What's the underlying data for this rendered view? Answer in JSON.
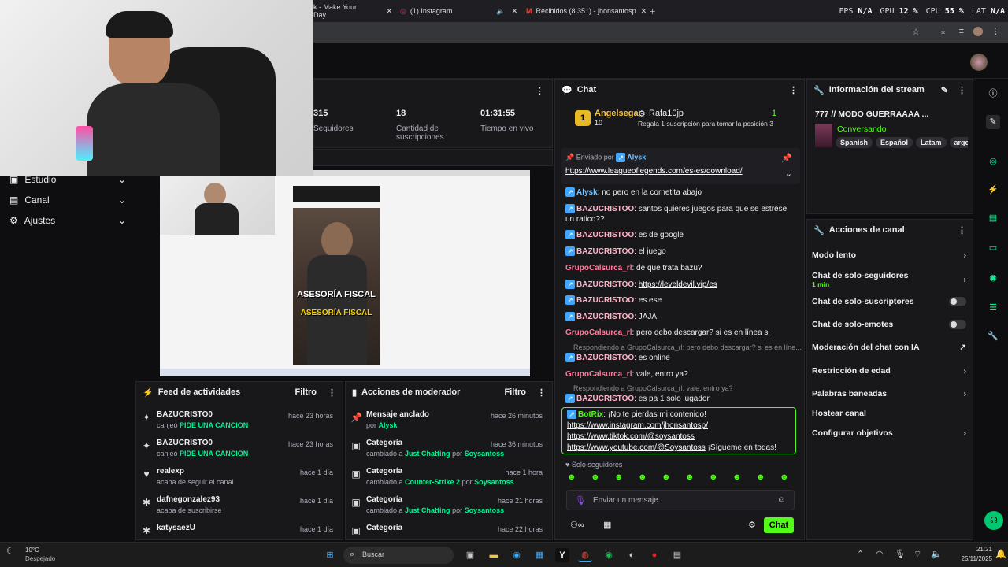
{
  "browser": {
    "tabs": [
      {
        "label": "k - Make Your Day"
      },
      {
        "label": "(1) Instagram"
      },
      {
        "label": "Recibidos (8,351) - jhonsantosp"
      }
    ],
    "hud": {
      "fps_label": "FPS",
      "fps": "N/A",
      "gpu_label": "GPU",
      "gpu": "12 %",
      "cpu_label": "CPU",
      "cpu": "55 %",
      "lat_label": "LAT",
      "lat": "N/A"
    }
  },
  "leftnav": {
    "items": [
      {
        "label": "Estudio"
      },
      {
        "label": "Canal"
      },
      {
        "label": "Ajustes"
      }
    ]
  },
  "stats": [
    {
      "value": "315",
      "label": "Seguidores"
    },
    {
      "value": "18",
      "label": "Cantidad de suscripciones"
    },
    {
      "value": "01:31:55",
      "label": "Tiempo en vivo"
    }
  ],
  "preview": {
    "overlay_line1": "ASESORÍA FISCAL",
    "overlay_line2": "ASESORÍA FISCAL"
  },
  "feed": {
    "title": "Feed de actividades",
    "filter": "Filtro",
    "items": [
      {
        "name": "BAZUCRISTO0",
        "action": "canjeó",
        "reward": "PIDE UNA CANCION",
        "time": "hace 23 horas",
        "icon": "points-icon"
      },
      {
        "name": "BAZUCRISTO0",
        "action": "canjeó",
        "reward": "PIDE UNA CANCION",
        "time": "hace 23 horas",
        "icon": "points-icon"
      },
      {
        "name": "realexp",
        "action": "acaba de seguir el canal",
        "reward": "",
        "time": "hace 1 día",
        "icon": "heart-icon"
      },
      {
        "name": "dafnegonzalez93",
        "action": "acaba de suscribirse",
        "reward": "",
        "time": "hace 1 día",
        "icon": "star-icon"
      },
      {
        "name": "katysaezU",
        "action": "",
        "reward": "",
        "time": "hace 1 día",
        "icon": "star-icon"
      }
    ]
  },
  "modactions": {
    "title": "Acciones de moderador",
    "filter": "Filtro",
    "items": [
      {
        "name": "Mensaje anclado",
        "line": "por",
        "a": "Alysk",
        "b": "",
        "by": "",
        "time": "hace 26 minutos",
        "icon": "pin-icon"
      },
      {
        "name": "Categoría",
        "line": "cambiado a",
        "a": "Just Chatting",
        "b": "por",
        "by": "Soysantoss",
        "time": "hace 36 minutos",
        "icon": "category-icon"
      },
      {
        "name": "Categoría",
        "line": "cambiado a",
        "a": "Counter-Strike 2",
        "b": "por",
        "by": "Soysantoss",
        "time": "hace 1 hora",
        "icon": "category-icon"
      },
      {
        "name": "Categoría",
        "line": "cambiado a",
        "a": "Just Chatting",
        "b": "por",
        "by": "Soysantoss",
        "time": "hace 21 horas",
        "icon": "category-icon"
      },
      {
        "name": "Categoría",
        "line": "",
        "a": "",
        "b": "",
        "by": "",
        "time": "hace 22 horas",
        "icon": "category-icon"
      }
    ]
  },
  "chat": {
    "title": "Chat",
    "leader": {
      "rank": "1",
      "name": "Angelsega",
      "count": "10",
      "other": "Rafa10jp",
      "other_count": "1",
      "promo": "Regala 1 suscripción para tomar la posición 3"
    },
    "pinned": {
      "by_label": "Enviado por",
      "by": "Alysk",
      "link": "https://www.leagueoflegends.com/es-es/download/"
    },
    "messages": [
      {
        "user": "Alysk",
        "text": ": no pero en la cornetita abajo"
      },
      {
        "user": "BAZUCRISTOO",
        "text": ": santos quieres juegos para que se estrese un ratico??"
      },
      {
        "user": "BAZUCRISTOO",
        "text": ": es de google"
      },
      {
        "user": "BAZUCRISTOO",
        "text": ": el juego"
      },
      {
        "user": "GrupoCalsurca_rl",
        "text": ": de que trata bazu?"
      },
      {
        "user": "BAZUCRISTOO",
        "text": ": ",
        "link": "https://leveldevil.vip/es"
      },
      {
        "user": "BAZUCRISTOO",
        "text": ": es ese"
      },
      {
        "user": "BAZUCRISTOO",
        "text": ": JAJA"
      },
      {
        "user": "GrupoCalsurca_rl",
        "text": ": pero debo descargar? si es en línea si"
      },
      {
        "user": "BAZUCRISTOO",
        "text": ": es online"
      },
      {
        "user": "GrupoCalsurca_rl",
        "text": ": vale, entro ya?"
      },
      {
        "user": "BAZUCRISTOO",
        "text": ": es pa 1 solo jugador"
      }
    ],
    "replies": [
      "Respondiendo a GrupoCalsurca_rl: pero debo descargar? si es en líne...",
      "Respondiendo a GrupoCalsurca_rl: vale, entro ya?"
    ],
    "bot": {
      "user": "BotRix",
      "text": ": ¡No te pierdas mi contenido!",
      "links": [
        "https://www.instagram.com/jhonsantosp/",
        "https://www.tiktok.com/@soysantoss",
        "https://www.youtube.com/@Soysantoss"
      ],
      "tail": "¡Sígueme en todas!"
    },
    "mode_label": "Solo seguidores",
    "input_placeholder": "Enviar un mensaje",
    "send_label": "Chat"
  },
  "streaminfo": {
    "title": "Información del stream",
    "stream_title": "777 // MODO GUERRAAAA ...",
    "category": "Conversando",
    "tags": [
      "Spanish",
      "Español",
      "Latam",
      "argen"
    ]
  },
  "channelactions": {
    "title": "Acciones de canal",
    "items": [
      {
        "label": "Modo lento",
        "sub": "",
        "control": "chevron"
      },
      {
        "label": "Chat de solo-seguidores",
        "sub": "1 min",
        "control": "chevron"
      },
      {
        "label": "Chat de solo-suscriptores",
        "sub": "",
        "control": "toggle"
      },
      {
        "label": "Chat de solo-emotes",
        "sub": "",
        "control": "toggle"
      },
      {
        "label": "Moderación del chat con IA",
        "sub": "",
        "control": "external"
      },
      {
        "label": "Restricción de edad",
        "sub": "",
        "control": "chevron"
      },
      {
        "label": "Palabras baneadas",
        "sub": "",
        "control": "chevron"
      },
      {
        "label": "Hostear canal",
        "sub": "",
        "control": "none"
      },
      {
        "label": "Configurar objetivos",
        "sub": "",
        "control": "chevron"
      }
    ]
  },
  "taskbar": {
    "weather_temp": "10°C",
    "weather_desc": "Despejado",
    "search_placeholder": "Buscar",
    "time": "21:21",
    "date": "25/11/2025"
  },
  "colors": {
    "accent": "#53fc18",
    "link_green": "#00f593",
    "panel": "#18181b",
    "bg": "#0e0e10"
  }
}
